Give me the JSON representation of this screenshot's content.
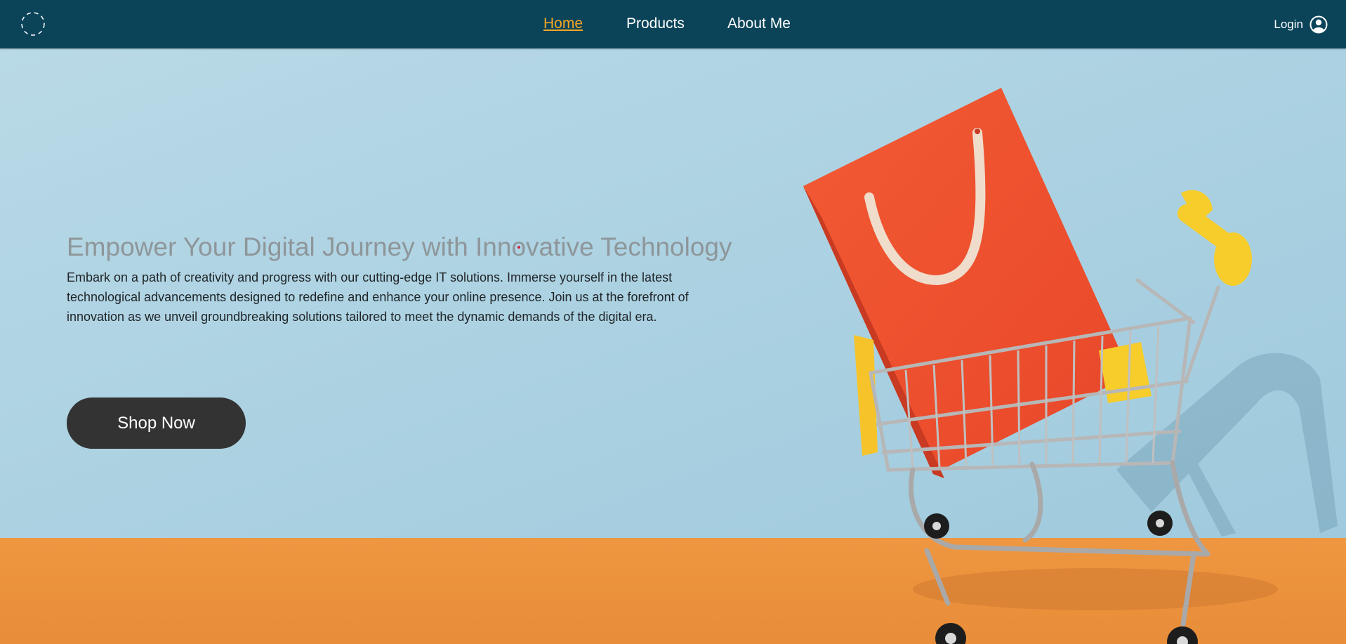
{
  "nav": {
    "logo_icon": "logo-icon",
    "links": [
      {
        "label": "Home",
        "active": true
      },
      {
        "label": "Products",
        "active": false
      },
      {
        "label": "About Me",
        "active": false
      }
    ],
    "login_label": "Login",
    "login_icon": "user-circle-icon"
  },
  "hero": {
    "title": "Empower Your Digital Journey with Innovative Technology",
    "description": "Embark on a path of creativity and progress with our cutting-edge IT solutions. Immerse yourself in the latest technological advancements designed to redefine and enhance your online presence. Join us at the forefront of innovation as we unveil groundbreaking solutions tailored to meet the dynamic demands of the digital era.",
    "cta_label": "Shop Now",
    "image": "shopping-cart-with-red-bag-photo"
  },
  "colors": {
    "nav_bg": "#0b4459",
    "active_link": "#f5a623",
    "button_bg": "#333333",
    "sky": "#a9d0e0",
    "floor": "#eb933e"
  }
}
